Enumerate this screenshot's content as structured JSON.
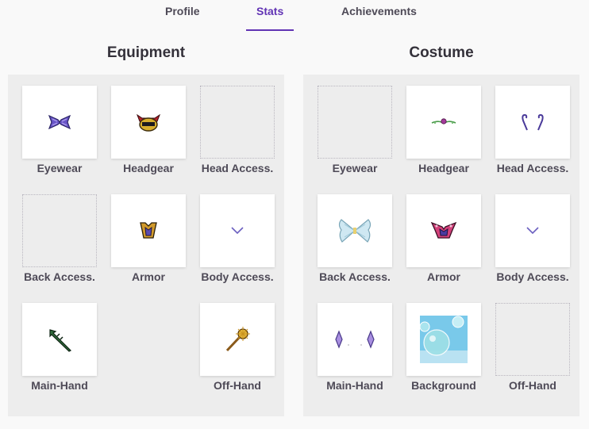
{
  "tabs": {
    "profile": "Profile",
    "stats": "Stats",
    "achievements": "Achievements"
  },
  "equipment": {
    "title": "Equipment",
    "slots": [
      {
        "label": "Eyewear",
        "icon": "purple-mask-icon",
        "empty": false
      },
      {
        "label": "Headgear",
        "icon": "red-gold-helm-icon",
        "empty": false
      },
      {
        "label": "Head Access.",
        "icon": "",
        "empty": true
      },
      {
        "label": "Back Access.",
        "icon": "",
        "empty": true
      },
      {
        "label": "Armor",
        "icon": "armor-icon",
        "empty": false
      },
      {
        "label": "Body Access.",
        "icon": "small-chevron-icon",
        "empty": false
      },
      {
        "label": "Main-Hand",
        "icon": "green-spear-icon",
        "empty": false
      },
      {
        "label": "Off-Hand",
        "icon": "gold-staff-icon",
        "empty": false
      }
    ]
  },
  "costume": {
    "title": "Costume",
    "slots": [
      {
        "label": "Eyewear",
        "icon": "",
        "empty": true
      },
      {
        "label": "Headgear",
        "icon": "flower-circlet-icon",
        "empty": false
      },
      {
        "label": "Head Access.",
        "icon": "antennae-icon",
        "empty": false
      },
      {
        "label": "Back Access.",
        "icon": "crystal-wings-icon",
        "empty": false
      },
      {
        "label": "Armor",
        "icon": "pink-armor-icon",
        "empty": false
      },
      {
        "label": "Body Access.",
        "icon": "small-chevron-icon",
        "empty": false
      },
      {
        "label": "Main-Hand",
        "icon": "twin-crystals-icon",
        "empty": false
      },
      {
        "label": "Background",
        "icon": "bubbles-background-icon",
        "empty": false
      },
      {
        "label": "Off-Hand",
        "icon": "",
        "empty": true
      }
    ]
  },
  "colors": {
    "accent": "#6133b4",
    "panel": "#ededed",
    "text": "#34313a"
  }
}
